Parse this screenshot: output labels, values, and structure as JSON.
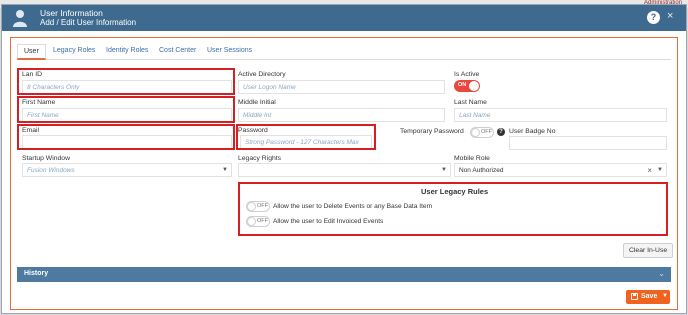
{
  "background": {
    "corner_text": "Administration"
  },
  "header": {
    "title": "User Information",
    "subtitle": "Add / Edit User Information",
    "help_label": "?",
    "close_label": "×",
    "user_icon": "user-icon",
    "color": "#3d6a8e"
  },
  "tabs": [
    {
      "label": "User",
      "active": true
    },
    {
      "label": "Legacy Roles",
      "active": false
    },
    {
      "label": "Identity Roles",
      "active": false
    },
    {
      "label": "Cost Center",
      "active": false
    },
    {
      "label": "User Sessions",
      "active": false
    }
  ],
  "form": {
    "lan_id": {
      "label": "Lan ID",
      "placeholder": "8 Characters Only",
      "value": ""
    },
    "active_directory": {
      "label": "Active Directory",
      "placeholder": "User Logon Name",
      "value": ""
    },
    "is_active": {
      "label": "Is Active",
      "toggle_text": "ON",
      "state": true
    },
    "first_name": {
      "label": "First Name",
      "placeholder": "First Name",
      "value": ""
    },
    "middle_initial": {
      "label": "Middle Initial",
      "placeholder": "Middle Int",
      "value": ""
    },
    "last_name": {
      "label": "Last Name",
      "placeholder": "Last Name",
      "value": ""
    },
    "email": {
      "label": "Email",
      "placeholder": "",
      "value": ""
    },
    "password": {
      "label": "Password",
      "placeholder": "Strong Password - 127 Characters Max",
      "value": ""
    },
    "temporary_password": {
      "label": "Temporary Password",
      "toggle_text": "OFF",
      "state": false,
      "help": "?"
    },
    "user_badge_no": {
      "label": "User Badge No",
      "value": ""
    },
    "startup_window": {
      "label": "Startup Window",
      "placeholder": "Fusion Windows",
      "value": ""
    },
    "legacy_rights": {
      "label": "Legacy Rights",
      "value": ""
    },
    "mobile_role": {
      "label": "Mobile Role",
      "value": "Non Authorized",
      "clear": "×"
    }
  },
  "legacy_rules": {
    "title": "User Legacy Rules",
    "rules": [
      {
        "toggle_text": "OFF",
        "label": "Allow the user to Delete Events or any Base Data Item",
        "state": false
      },
      {
        "toggle_text": "OFF",
        "label": "Allow the user to Edit Invoiced Events",
        "state": false
      }
    ]
  },
  "buttons": {
    "clear_in_use": "Clear In-Use",
    "save": "Save"
  },
  "history": {
    "label": "History"
  },
  "colors": {
    "accent": "#e86a3c",
    "highlight": "#d41f25",
    "toggle_on": "#e9463d",
    "history_bar": "#4f7aa0",
    "save": "#f0621e"
  }
}
